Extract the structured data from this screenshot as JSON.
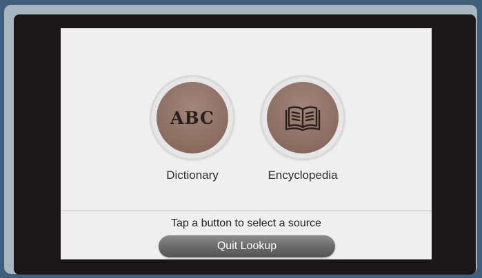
{
  "lookup": {
    "dictionary": {
      "icon_text": "ABC",
      "label": "Dictionary"
    },
    "encyclopedia": {
      "icon": "open-book-icon",
      "label": "Encyclopedia"
    },
    "prompt": "Tap a button to select a source",
    "quit_label": "Quit Lookup"
  },
  "colors": {
    "page_background": "#3f5f7c",
    "bezel": "#1c1819",
    "screen": "#efefef",
    "disc": "#8a6c60",
    "quit_button": "#6b6b6b"
  }
}
